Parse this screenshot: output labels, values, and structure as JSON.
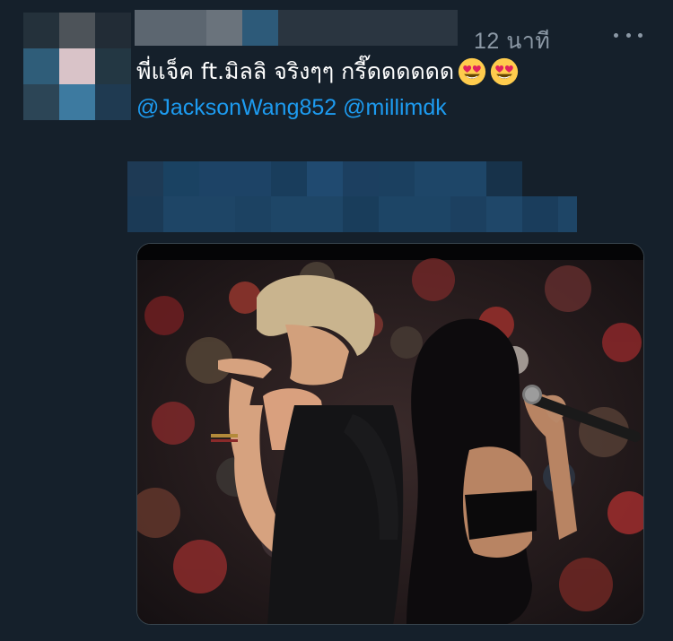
{
  "tweet": {
    "time": "12 นาที",
    "text": "พี่แจ็ค ft.มิลลิ จริงๆๆ กรี๊ดดดดดด",
    "emoji": "smiling-face-with-heart-eyes",
    "mentions": [
      "@JacksonWang852",
      "@millimdk"
    ]
  },
  "colors": {
    "background": "#15202b",
    "mention": "#1d9bf0",
    "secondary_text": "#8b98a5",
    "border": "#38444d"
  },
  "icons": {
    "more": "more-dots-icon"
  }
}
